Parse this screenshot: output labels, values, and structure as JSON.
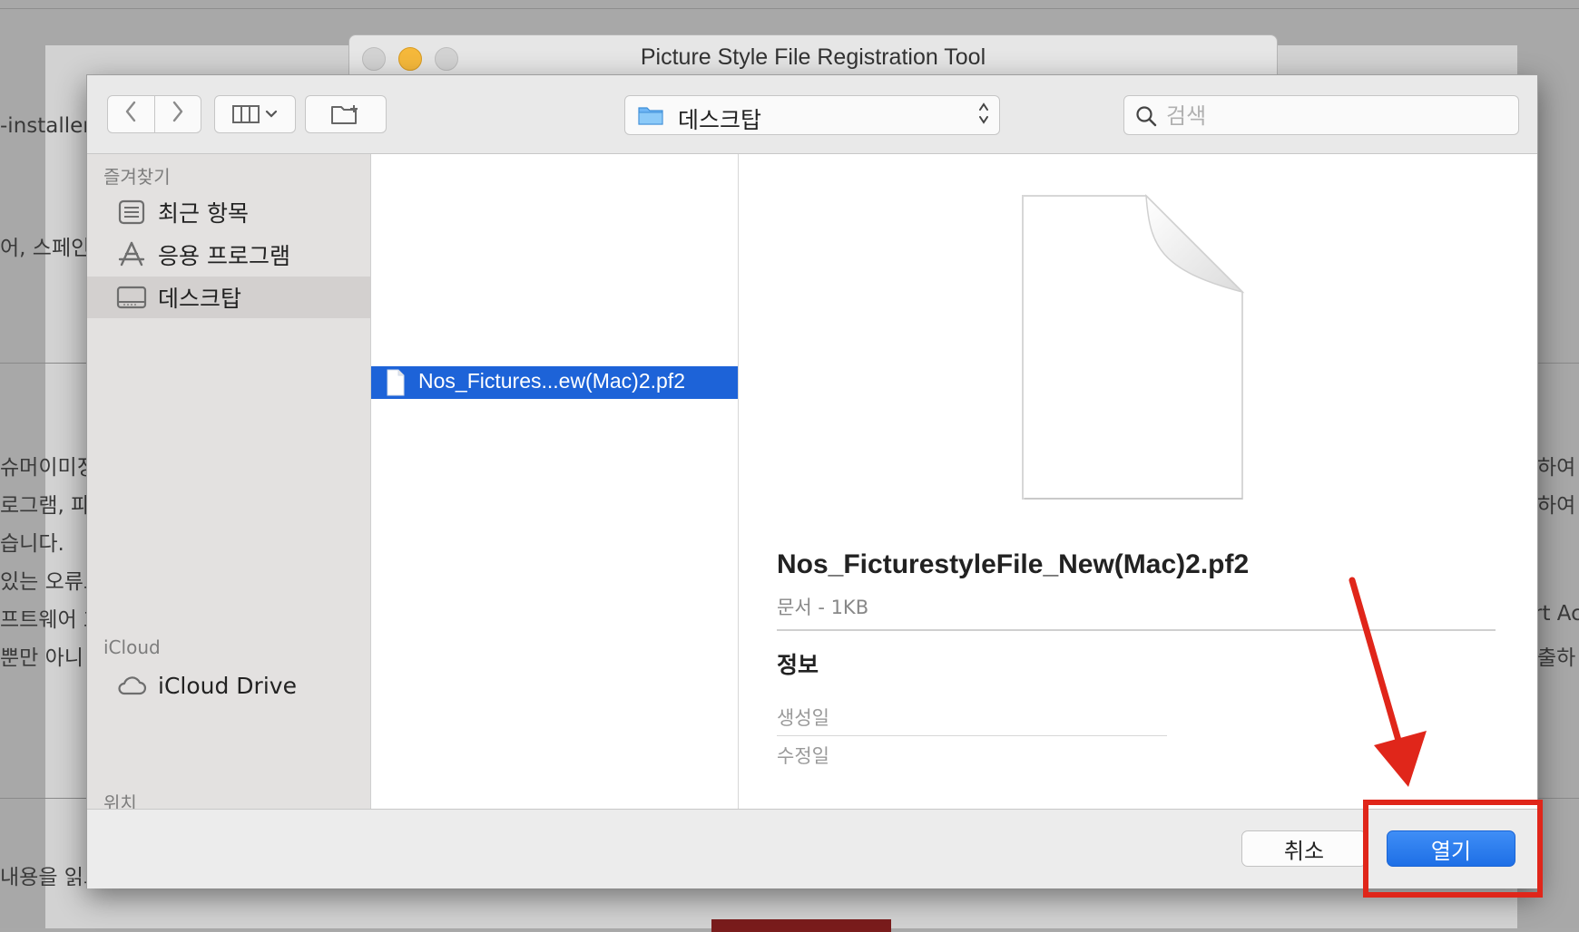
{
  "background_page": {
    "texts": [
      {
        "id": "installer",
        "text": "-installer"
      },
      {
        "id": "spanish",
        "text": "어, 스페인"
      },
      {
        "id": "l1",
        "text": "슈머이미징"
      },
      {
        "id": "l2",
        "text": "로그램, 파"
      },
      {
        "id": "l3",
        "text": "습니다."
      },
      {
        "id": "l4",
        "text": "있는 오류로"
      },
      {
        "id": "l5",
        "text": "프트웨어 호"
      },
      {
        "id": "l6",
        "text": " 뿐만 아니"
      },
      {
        "id": "l7",
        "text": "내용을 읽고"
      },
      {
        "id": "r1",
        "text": "하여 "
      },
      {
        "id": "r2",
        "text": "하여"
      },
      {
        "id": "r3",
        "text": "rt Ac"
      },
      {
        "id": "r4",
        "text": "출하"
      }
    ]
  },
  "tool_window": {
    "title": "Picture Style File Registration Tool"
  },
  "toolbar": {
    "back_icon": "chevron-left-icon",
    "forward_icon": "chevron-right-icon",
    "view_icon": "column-view-icon",
    "new_folder_icon": "new-folder-icon",
    "location_label": "데스크탑",
    "search_placeholder": "검색"
  },
  "sidebar": {
    "favorites_heading": "즐겨찾기",
    "favorites": [
      {
        "label": "최근 항목",
        "icon": "recents-icon",
        "selected": false
      },
      {
        "label": "응용 프로그램",
        "icon": "applications-icon",
        "selected": false
      },
      {
        "label": "데스크탑",
        "icon": "desktop-icon",
        "selected": true
      }
    ],
    "icloud_heading": "iCloud",
    "icloud_items": [
      {
        "label": "iCloud Drive",
        "icon": "cloud-icon"
      }
    ],
    "locations_heading": "위치"
  },
  "file_list": {
    "selected_file": "Nos_Fictures...ew(Mac)2.pf2"
  },
  "preview": {
    "file_name": "Nos_FicturestyleFile_New(Mac)2.pf2",
    "kind": "문서 - 1KB",
    "info_heading": "정보",
    "created_label": "생성일",
    "modified_label": "수정일"
  },
  "footer": {
    "cancel_label": "취소",
    "open_label": "열기"
  },
  "annotation": {
    "color": "#e0261a"
  }
}
